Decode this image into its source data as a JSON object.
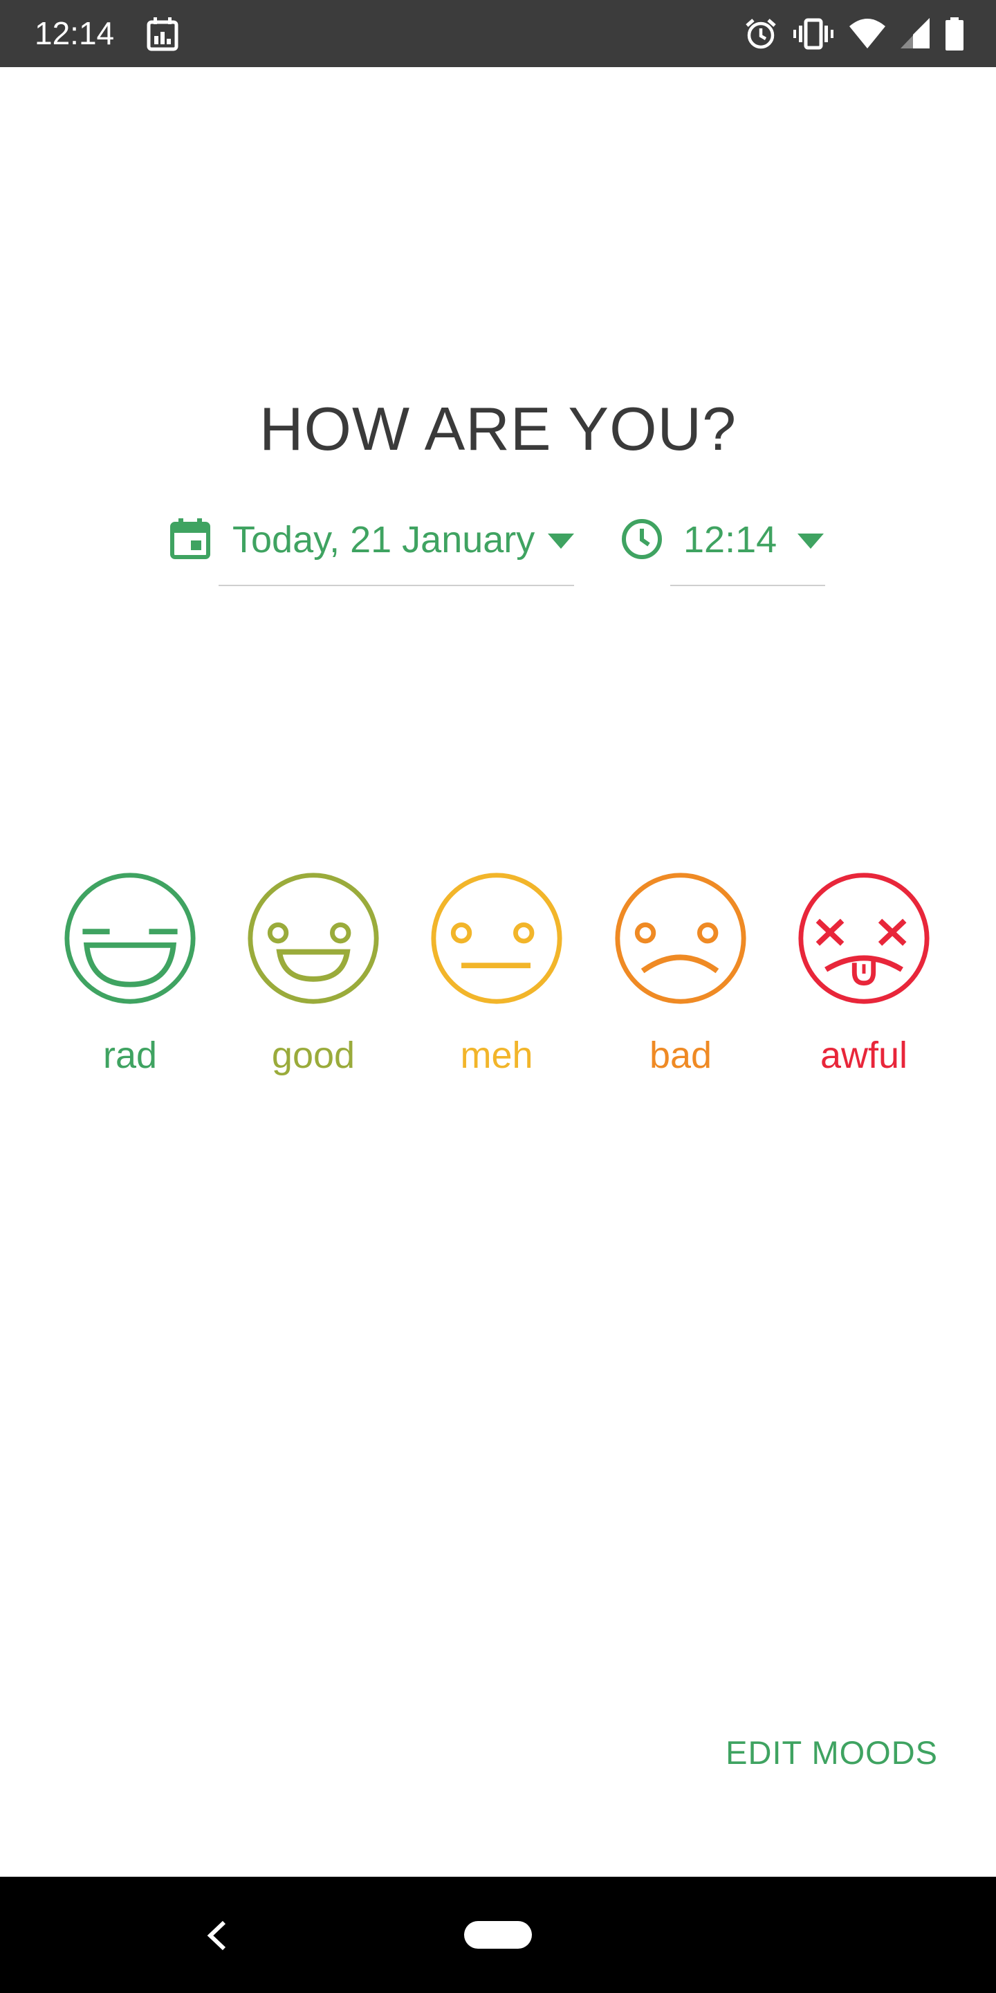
{
  "status_bar": {
    "time": "12:14",
    "icons": [
      "calendar-icon",
      "alarm-icon",
      "vibrate-icon",
      "wifi-icon",
      "signal-icon",
      "battery-icon"
    ]
  },
  "prompt": {
    "title": "HOW ARE YOU?"
  },
  "pickers": {
    "date_label": "Today, 21 January",
    "time_label": "12:14",
    "accent": "#3fa361"
  },
  "moods": [
    {
      "label": "rad",
      "color": "#3fa361",
      "icon": "rad-face-icon"
    },
    {
      "label": "good",
      "color": "#9aab3b",
      "icon": "good-face-icon"
    },
    {
      "label": "meh",
      "color": "#f2b52a",
      "icon": "meh-face-icon"
    },
    {
      "label": "bad",
      "color": "#ef8a24",
      "icon": "bad-face-icon"
    },
    {
      "label": "awful",
      "color": "#e8263a",
      "icon": "awful-face-icon"
    }
  ],
  "actions": {
    "edit_moods_label": "EDIT MOODS"
  },
  "nav_bar": {
    "icons": [
      "back-icon",
      "home-pill-icon"
    ]
  }
}
